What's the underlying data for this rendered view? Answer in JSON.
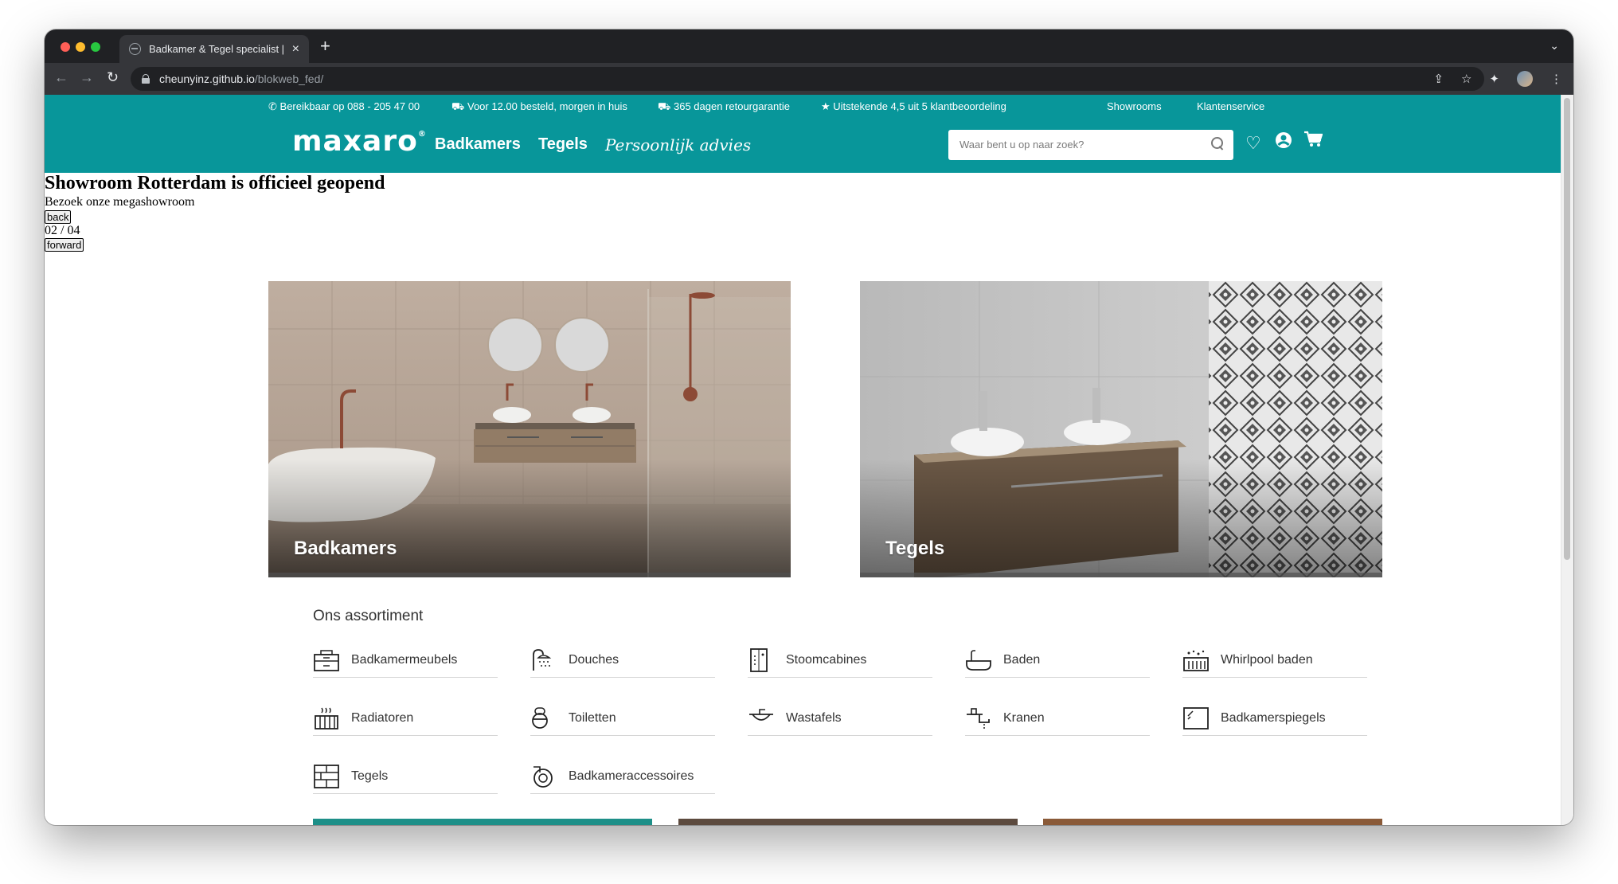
{
  "browser": {
    "tab_title": "Badkamer & Tegel specialist | M",
    "url_host": "cheunyinz.github.io",
    "url_path": "/blokweb_fed/"
  },
  "topstrip": {
    "phone": "Bereikbaar op 088 - 205 47 00",
    "delivery": "Voor 12.00 besteld, morgen in huis",
    "returns": "365 dagen retourgarantie",
    "rating": "Uitstekende 4,5 uit 5 klantbeoordeling",
    "showrooms": "Showrooms",
    "service": "Klantenservice"
  },
  "nav": {
    "logo": "maxaro",
    "links": [
      "Badkamers",
      "Tegels",
      "Persoonlijk advies"
    ],
    "search_placeholder": "Waar bent u op naar zoek?"
  },
  "hero": {
    "title": "Showroom Rotterdam is officieel geopend",
    "subtitle": "Bezoek onze megashowroom",
    "back": "back",
    "counter": "02 / 04",
    "forward": "forward"
  },
  "cards": [
    {
      "label": "Badkamers"
    },
    {
      "label": "Tegels"
    }
  ],
  "assortiment": {
    "title": "Ons assortiment",
    "items": [
      {
        "label": "Badkamermeubels",
        "icon": "cabinet-icon"
      },
      {
        "label": "Douches",
        "icon": "shower-icon"
      },
      {
        "label": "Stoomcabines",
        "icon": "steam-cabin-icon"
      },
      {
        "label": "Baden",
        "icon": "bathtub-icon"
      },
      {
        "label": "Whirlpool baden",
        "icon": "whirlpool-icon"
      },
      {
        "label": "Radiatoren",
        "icon": "radiator-icon"
      },
      {
        "label": "Toiletten",
        "icon": "toilet-icon"
      },
      {
        "label": "Wastafels",
        "icon": "sink-icon"
      },
      {
        "label": "Kranen",
        "icon": "faucet-icon"
      },
      {
        "label": "Badkamerspiegels",
        "icon": "mirror-icon"
      },
      {
        "label": "Tegels",
        "icon": "tiles-icon"
      },
      {
        "label": "Badkameraccessoires",
        "icon": "accessory-icon"
      }
    ]
  },
  "colors": {
    "brand": "#08969a"
  }
}
